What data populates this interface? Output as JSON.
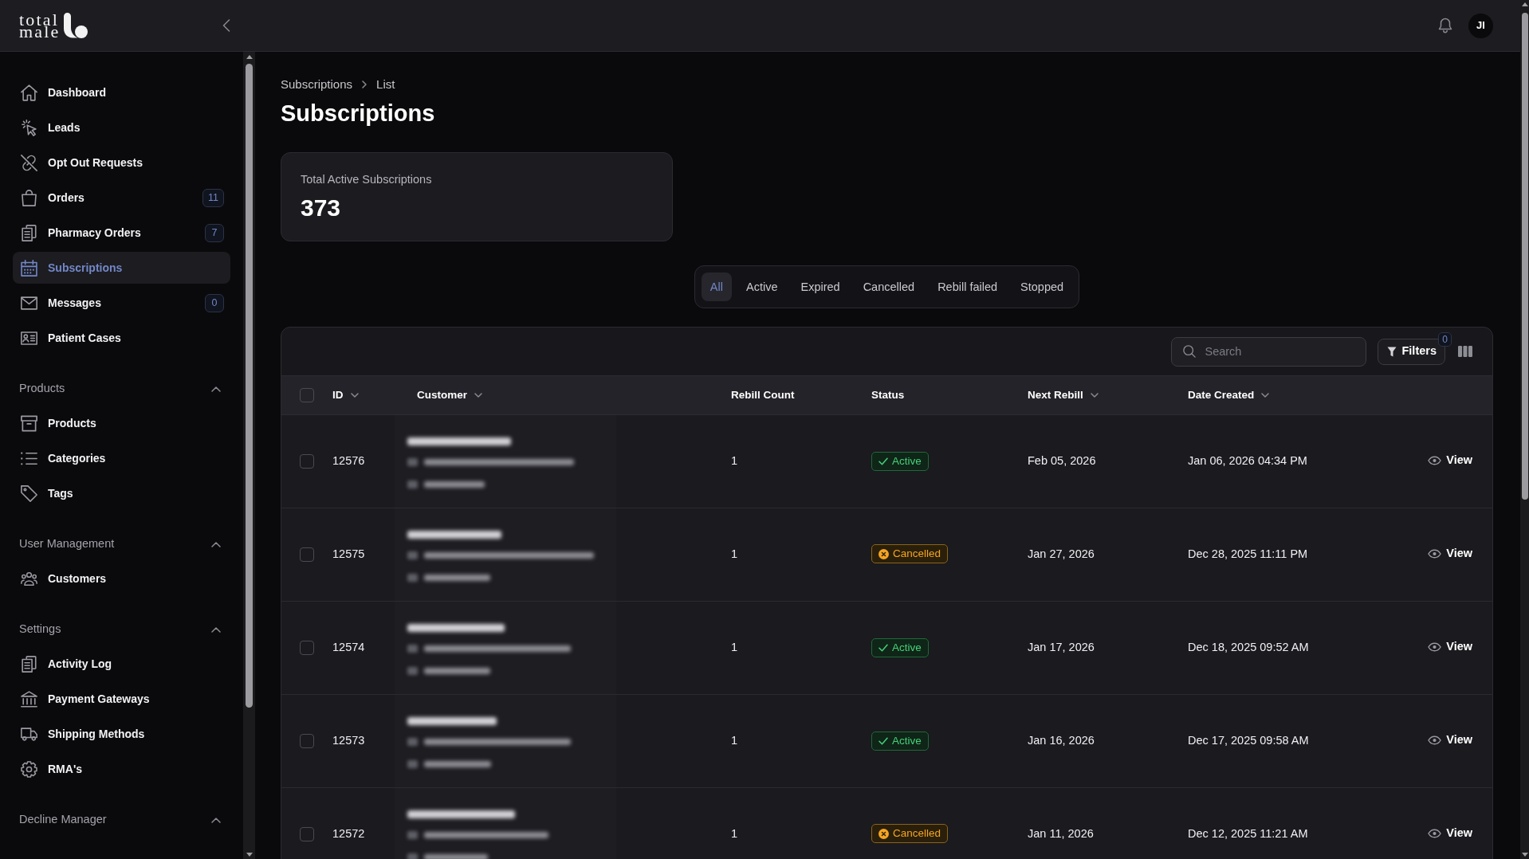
{
  "logo": {
    "lines": [
      "total",
      "male"
    ]
  },
  "header": {
    "avatar": "JI"
  },
  "sidebar": {
    "items": [
      {
        "label": "Dashboard",
        "selected": false
      },
      {
        "label": "Leads",
        "selected": false
      },
      {
        "label": "Opt Out Requests",
        "selected": false
      },
      {
        "label": "Orders",
        "selected": false,
        "badge": "11"
      },
      {
        "label": "Pharmacy Orders",
        "selected": false,
        "badge": "7"
      },
      {
        "label": "Subscriptions",
        "selected": true
      },
      {
        "label": "Messages",
        "selected": false,
        "badge": "0"
      },
      {
        "label": "Patient Cases",
        "selected": false
      }
    ],
    "sections": [
      {
        "title": "Products",
        "expanded": true,
        "items": [
          {
            "label": "Products",
            "selected": false
          },
          {
            "label": "Categories",
            "selected": false
          },
          {
            "label": "Tags",
            "selected": false
          }
        ]
      },
      {
        "title": "User Management",
        "expanded": true,
        "items": [
          {
            "label": "Customers",
            "selected": false
          }
        ]
      },
      {
        "title": "Settings",
        "expanded": true,
        "items": [
          {
            "label": "Activity Log",
            "selected": false
          },
          {
            "label": "Payment Gateways",
            "selected": false
          },
          {
            "label": "Shipping Methods",
            "selected": false
          },
          {
            "label": "RMA's",
            "selected": false
          }
        ]
      },
      {
        "title": "Decline Manager",
        "expanded": true
      }
    ]
  },
  "breadcrumb": [
    "Subscriptions",
    "List"
  ],
  "page_title": "Subscriptions",
  "summary": {
    "label": "Total Active Subscriptions",
    "value": "373"
  },
  "tabs": [
    {
      "label": "All",
      "selected": true
    },
    {
      "label": "Active",
      "selected": false
    },
    {
      "label": "Expired",
      "selected": false
    },
    {
      "label": "Cancelled",
      "selected": false
    },
    {
      "label": "Rebill failed",
      "selected": false
    },
    {
      "label": "Stopped",
      "selected": false
    }
  ],
  "toolbar": {
    "search": {
      "placeholder": "Search"
    },
    "filters": {
      "label": "Filters",
      "count": "0"
    }
  },
  "table": {
    "select_all": {
      "checked": false
    },
    "columns": [
      {
        "label": "ID",
        "sortable": true
      },
      {
        "label": "Customer",
        "sortable": true
      },
      {
        "label": "Rebill Count",
        "sortable": false
      },
      {
        "label": "Status",
        "sortable": false
      },
      {
        "label": "Next Rebill",
        "sortable": true
      },
      {
        "label": "Date Created",
        "sortable": true
      }
    ],
    "rows": [
      {
        "checked": false,
        "id": "12576",
        "rebill_count": "1",
        "status": {
          "kind": "active",
          "label": "Active"
        },
        "next_rebill": "Feb 05, 2026",
        "date_created": "Jan 06, 2026 04:34 PM",
        "action": "View"
      },
      {
        "checked": false,
        "id": "12575",
        "rebill_count": "1",
        "status": {
          "kind": "cancelled",
          "label": "Cancelled"
        },
        "next_rebill": "Jan 27, 2026",
        "date_created": "Dec 28, 2025 11:11 PM",
        "action": "View"
      },
      {
        "checked": false,
        "id": "12574",
        "rebill_count": "1",
        "status": {
          "kind": "active",
          "label": "Active"
        },
        "next_rebill": "Jan 17, 2026",
        "date_created": "Dec 18, 2025 09:52 AM",
        "action": "View"
      },
      {
        "checked": false,
        "id": "12573",
        "rebill_count": "1",
        "status": {
          "kind": "active",
          "label": "Active"
        },
        "next_rebill": "Jan 16, 2026",
        "date_created": "Dec 17, 2025 09:58 AM",
        "action": "View"
      },
      {
        "checked": false,
        "id": "12572",
        "rebill_count": "1",
        "status": {
          "kind": "cancelled",
          "label": "Cancelled"
        },
        "next_rebill": "Jan 11, 2026",
        "date_created": "Dec 12, 2025 11:21 AM",
        "action": "View"
      }
    ]
  }
}
